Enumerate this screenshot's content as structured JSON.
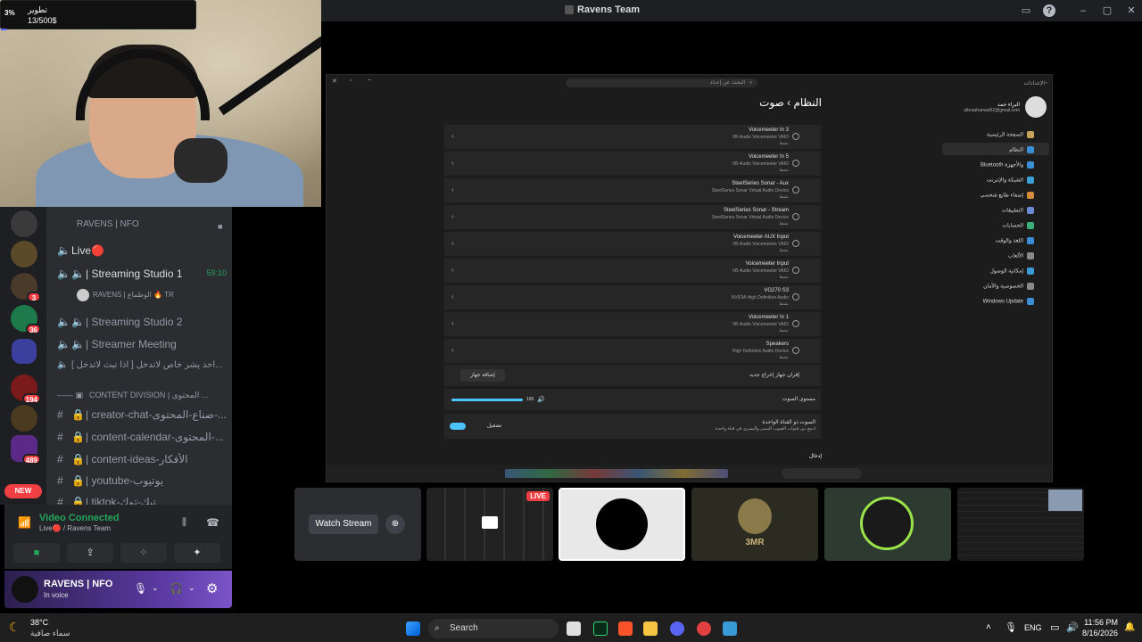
{
  "stream_goal": {
    "percent_label": "3%",
    "title": "تطوير",
    "progress_text": "13/500$",
    "progress": 0.03
  },
  "window": {
    "title": "Ravens Team"
  },
  "servers": [
    {
      "name": "server-rc",
      "badge": "",
      "color": "#3a3a3a"
    },
    {
      "name": "server-2",
      "badge": "",
      "color": "#5a4a2a"
    },
    {
      "name": "server-3",
      "badge": "3",
      "color": "#4a3a2a"
    },
    {
      "name": "server-4",
      "badge": "36",
      "color": "#1e7a4a"
    },
    {
      "name": "server-folder",
      "badge": "",
      "color": "#3b3f9e"
    },
    {
      "name": "server-6",
      "badge": "194",
      "color": "#7a1a1a"
    },
    {
      "name": "server-7",
      "badge": "",
      "color": "#4a3a20"
    },
    {
      "name": "server-8",
      "badge": "489",
      "color": "#5b2a88"
    }
  ],
  "new_badge": "NEW",
  "channels": {
    "header": "RAVENS | NFO",
    "items": [
      {
        "label": "Live🔴",
        "kind": "voice"
      },
      {
        "label": "| Streaming Studio 1",
        "kind": "voice",
        "timer": "59:10"
      },
      {
        "label": "RAVENS | الوطماع 🔥 TR",
        "kind": "user"
      },
      {
        "label": "| Streaming Studio 2",
        "kind": "voice"
      },
      {
        "label": "| Streamer Meeting",
        "kind": "voice"
      },
      {
        "label": "[ اذا تبث لاتدخل ] احد يشر خاص لاتدخل...",
        "kind": "voice"
      },
      {
        "label": "CONTENT DIVISION | المحتوى ...",
        "kind": "category"
      },
      {
        "label": "| creator-chat-صناع-المحتوى-...",
        "kind": "text"
      },
      {
        "label": "| content-calendar-المحتوى-...",
        "kind": "text"
      },
      {
        "label": "| content-ideas-الأفكار",
        "kind": "text"
      },
      {
        "label": "| youtube-يوتيوب",
        "kind": "text"
      },
      {
        "label": "| tiktok-تيك-توك",
        "kind": "text"
      }
    ]
  },
  "voice_panel": {
    "status": "Video Connected",
    "sub": "Live🔴 / Ravens Team"
  },
  "user_panel": {
    "name": "RAVENS | NFO",
    "status": "In voice"
  },
  "stream": {
    "search_placeholder": "البحث عن إعداد",
    "settings_title": "الإعدادات",
    "breadcrumb": "النظام  ›  صوت",
    "user_name": "البراء حمد",
    "user_email": "albraahamad62@gmail.com",
    "nav": [
      {
        "label": "الصفحة الرئيسية",
        "color": "#c8a15a"
      },
      {
        "label": "النظام",
        "color": "#3a8fd6"
      },
      {
        "label": "Bluetooth والأجهزة",
        "color": "#3a8fd6"
      },
      {
        "label": "الشبكة والإنترنت",
        "color": "#3aa0d6"
      },
      {
        "label": "إضفاء طابع شخصي",
        "color": "#d68a3a"
      },
      {
        "label": "التطبيقات",
        "color": "#6a8ad6"
      },
      {
        "label": "الحسابات",
        "color": "#3ab07a"
      },
      {
        "label": "اللغة والوقت",
        "color": "#3a8fd6"
      },
      {
        "label": "الألعاب",
        "color": "#8a8a8a"
      },
      {
        "label": "إمكانية الوصول",
        "color": "#3a9ad6"
      },
      {
        "label": "الخصوصية والأمان",
        "color": "#8a8a8a"
      },
      {
        "label": "Windows Update",
        "color": "#3a8fd6"
      }
    ],
    "devices": [
      {
        "name": "Voicemeeter In 3",
        "sub": "VB-Audio Voicemeeter VAIO",
        "status": "نشط"
      },
      {
        "name": "Voicemeeter In 5",
        "sub": "VB-Audio Voicemeeter VAIO",
        "status": "نشط"
      },
      {
        "name": "SteelSeries Sonar - Aux",
        "sub": "SteelSeries Sonar Virtual Audio Device",
        "status": "نشط"
      },
      {
        "name": "SteelSeries Sonar - Stream",
        "sub": "SteelSeries Sonar Virtual Audio Device",
        "status": "نشط"
      },
      {
        "name": "Voicemeeter AUX Input",
        "sub": "VB-Audio Voicemeeter VAIO",
        "status": "نشط"
      },
      {
        "name": "Voicemeeter Input",
        "sub": "VB-Audio Voicemeeter VAIO",
        "status": "نشط"
      },
      {
        "name": "VG270 S3",
        "sub": "NVIDIA High Definition Audio",
        "status": "نشط"
      },
      {
        "name": "Voicemeeter In 1",
        "sub": "VB-Audio Voicemeeter VAIO",
        "status": "نشط"
      },
      {
        "name": "Speakers",
        "sub": "High Definition Audio Device",
        "status": "نشط"
      }
    ],
    "add_device_label": "إقران جهاز إخراج جديد",
    "add_device_button": "إضافة جهاز",
    "volume_label": "مستوى الصوت",
    "volume_value": "100",
    "mono_title": "الصوت ذو القناة الواحدة",
    "mono_desc": "ادمج بين قنوات الصوت اليمنى واليسرى في قناة واحدة",
    "mono_toggle_label": "تشغيل",
    "input_heading": "إدخال"
  },
  "tiles": [
    {
      "name": "watch-stream",
      "label": "Watch Stream"
    },
    {
      "name": "live-stream",
      "badge": "LIVE"
    },
    {
      "name": "user-wolf"
    },
    {
      "name": "user-3mr",
      "label": "3MR"
    },
    {
      "name": "user-green"
    },
    {
      "name": "user-screen"
    }
  ],
  "taskbar": {
    "weather_temp": "38°C",
    "weather_desc": "سماء صافية",
    "search": "Search",
    "lang": "ENG",
    "time": "11:56 PM",
    "date": "8/16/2026"
  }
}
